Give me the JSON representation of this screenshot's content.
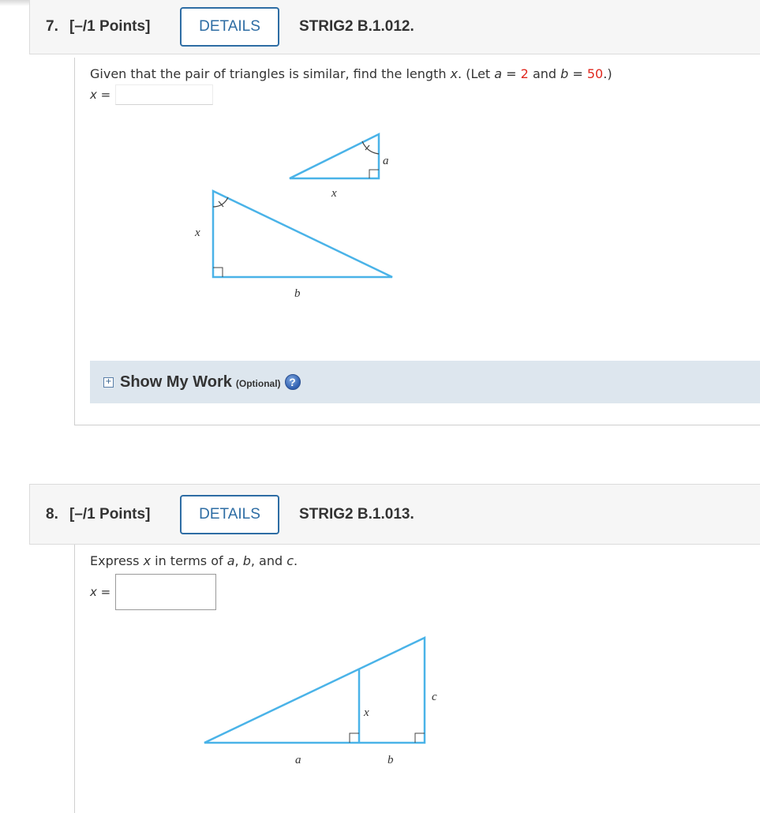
{
  "questions": [
    {
      "number": "7.",
      "points": "[–/1 Points]",
      "details_label": "DETAILS",
      "code": "STRIG2 B.1.012.",
      "prompt": {
        "text_before": "Given that the pair of triangles is similar, find the length ",
        "var_x": "x",
        "text_let": ". (Let ",
        "var_a": "a",
        "eq1": " = ",
        "a_value": "2",
        "and": " and ",
        "var_b": "b",
        "eq2": " = ",
        "b_value": "50",
        "close": ".)"
      },
      "answer_label": "x =",
      "answer_value": "",
      "figure_labels": {
        "small_side": "a",
        "small_base": "x",
        "large_side": "x",
        "large_base": "b"
      },
      "show_work": {
        "title": "Show My Work",
        "optional": "(Optional)",
        "help": "?"
      }
    },
    {
      "number": "8.",
      "points": "[–/1 Points]",
      "details_label": "DETAILS",
      "code": "STRIG2 B.1.013.",
      "prompt": {
        "text1": "Express ",
        "var_x": "x",
        "text2": " in terms of ",
        "var_a": "a",
        "comma1": ", ",
        "var_b": "b",
        "text3": ", and ",
        "var_c": "c",
        "end": "."
      },
      "answer_label": "x =",
      "answer_value": "",
      "figure_labels": {
        "base_left": "a",
        "base_right": "b",
        "inner_height": "x",
        "outer_height": "c"
      }
    }
  ],
  "colors": {
    "accent": "#2e6da4",
    "given_value": "#e0281e",
    "triangle_stroke": "#4ab3e8",
    "show_work_bg": "#dde6ee"
  }
}
